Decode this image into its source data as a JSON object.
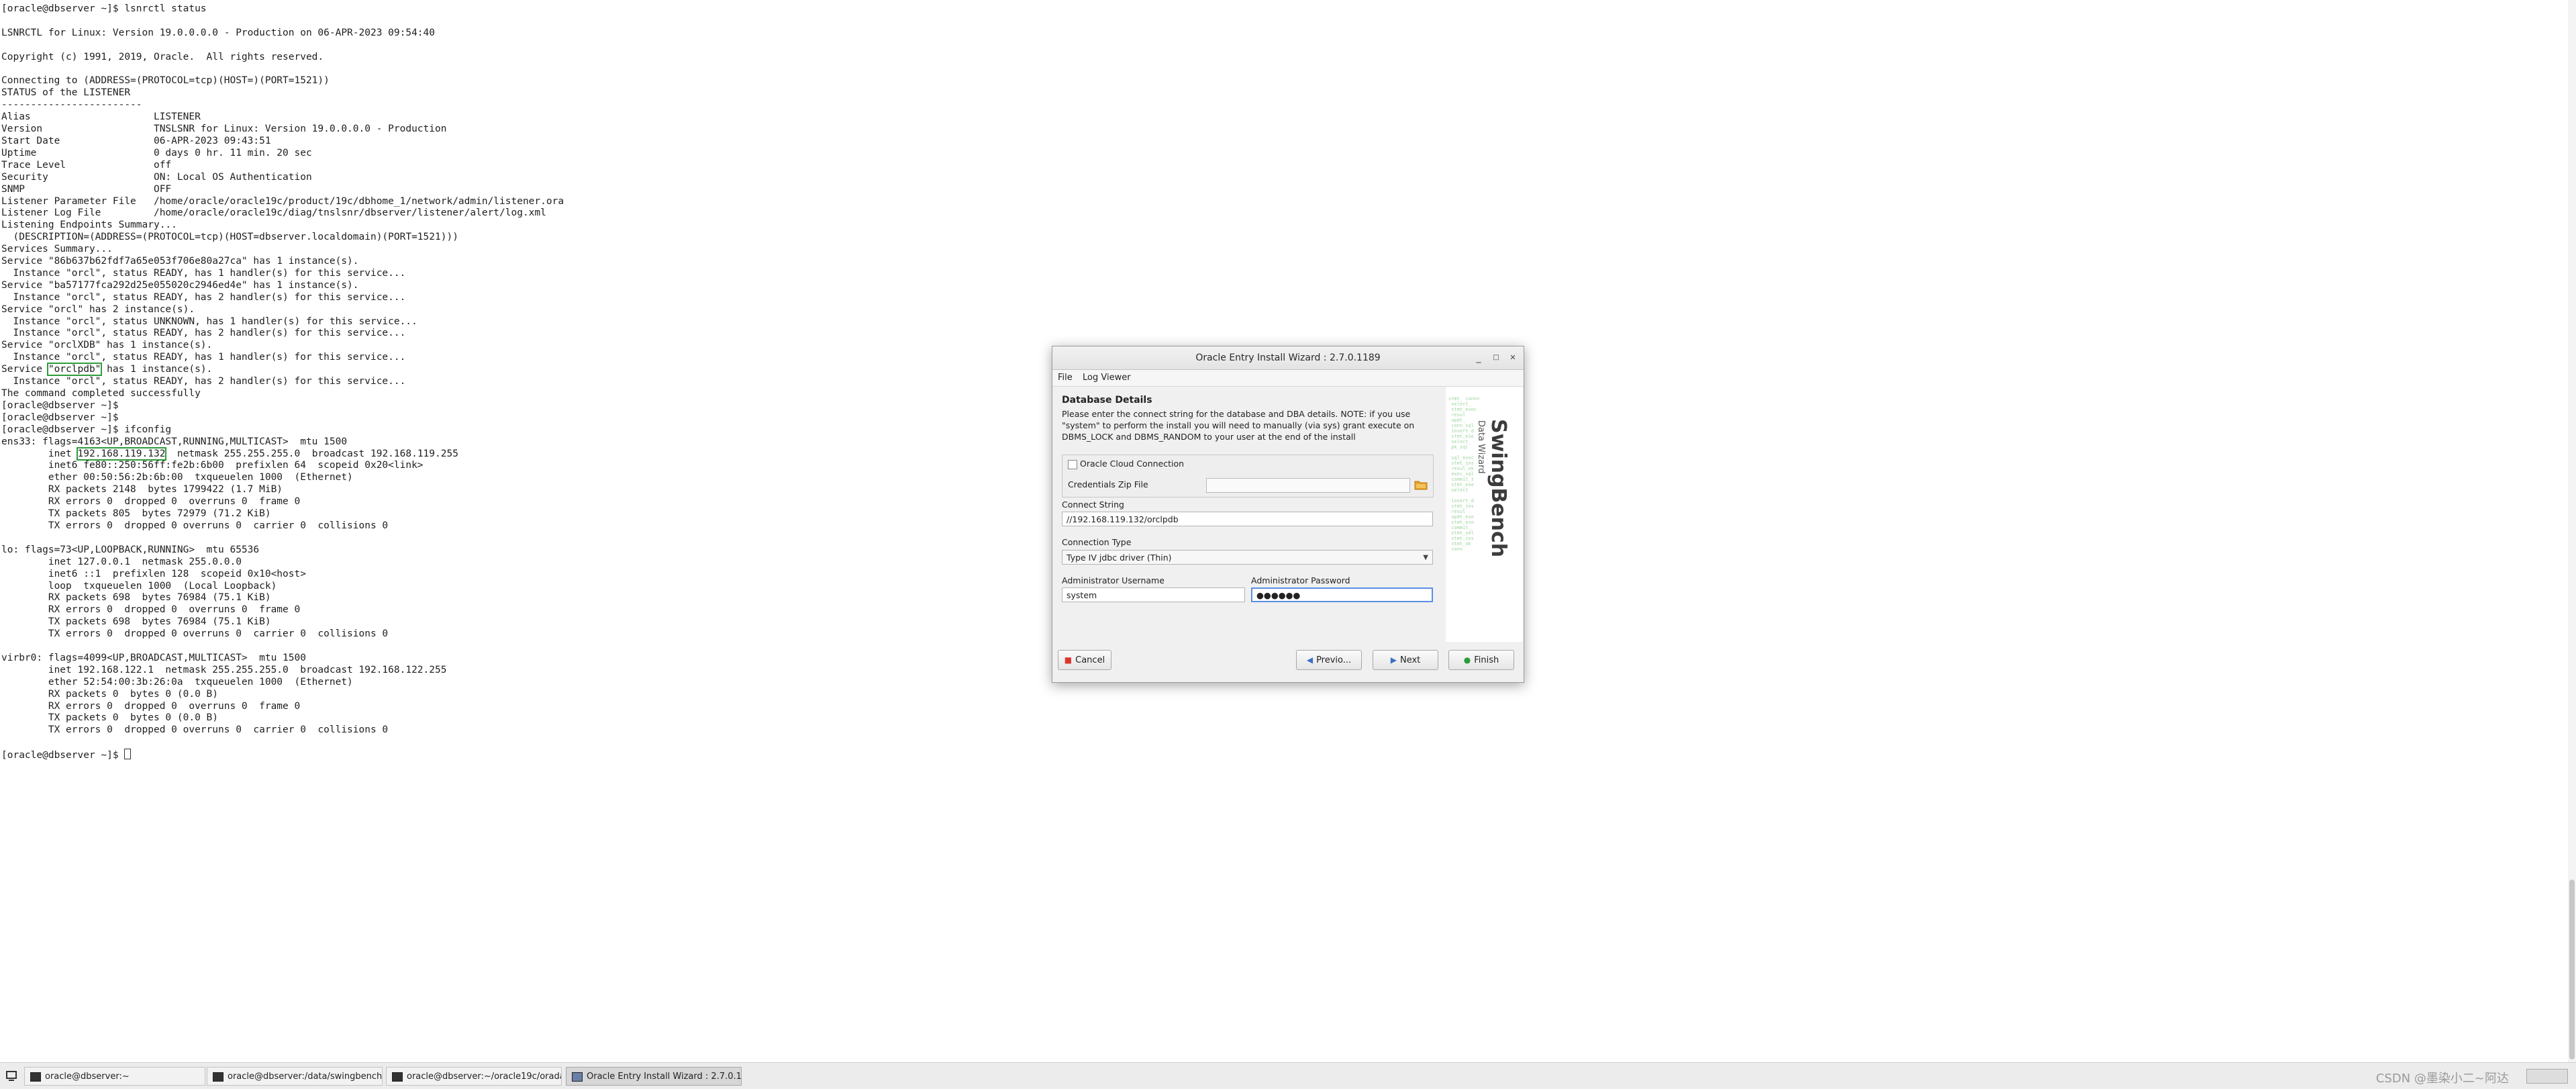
{
  "terminal": {
    "lines": [
      "[oracle@dbserver ~]$ lsnrctl status",
      "",
      "LSNRCTL for Linux: Version 19.0.0.0.0 - Production on 06-APR-2023 09:54:40",
      "",
      "Copyright (c) 1991, 2019, Oracle.  All rights reserved.",
      "",
      "Connecting to (ADDRESS=(PROTOCOL=tcp)(HOST=)(PORT=1521))",
      "STATUS of the LISTENER",
      "------------------------",
      "Alias                     LISTENER",
      "Version                   TNSLSNR for Linux: Version 19.0.0.0.0 - Production",
      "Start Date                06-APR-2023 09:43:51",
      "Uptime                    0 days 0 hr. 11 min. 20 sec",
      "Trace Level               off",
      "Security                  ON: Local OS Authentication",
      "SNMP                      OFF",
      "Listener Parameter File   /home/oracle/oracle19c/product/19c/dbhome_1/network/admin/listener.ora",
      "Listener Log File         /home/oracle/oracle19c/diag/tnslsnr/dbserver/listener/alert/log.xml",
      "Listening Endpoints Summary...",
      "  (DESCRIPTION=(ADDRESS=(PROTOCOL=tcp)(HOST=dbserver.localdomain)(PORT=1521)))",
      "Services Summary...",
      "Service \"86b637b62fdf7a65e053f706e80a27ca\" has 1 instance(s).",
      "  Instance \"orcl\", status READY, has 1 handler(s) for this service...",
      "Service \"ba57177fca292d25e055020c2946ed4e\" has 1 instance(s).",
      "  Instance \"orcl\", status READY, has 2 handler(s) for this service...",
      "Service \"orcl\" has 2 instance(s).",
      "  Instance \"orcl\", status UNKNOWN, has 1 handler(s) for this service...",
      "  Instance \"orcl\", status READY, has 2 handler(s) for this service...",
      "Service \"orclXDB\" has 1 instance(s).",
      "  Instance \"orcl\", status READY, has 1 handler(s) for this service...",
      "Service \"orclpdb\" has 1 instance(s).",
      "  Instance \"orcl\", status READY, has 2 handler(s) for this service...",
      "The command completed successfully",
      "[oracle@dbserver ~]$",
      "[oracle@dbserver ~]$",
      "[oracle@dbserver ~]$ ifconfig",
      "ens33: flags=4163<UP,BROADCAST,RUNNING,MULTICAST>  mtu 1500",
      "        inet 192.168.119.132  netmask 255.255.255.0  broadcast 192.168.119.255",
      "        inet6 fe80::250:56ff:fe2b:6b00  prefixlen 64  scopeid 0x20<link>",
      "        ether 00:50:56:2b:6b:00  txqueuelen 1000  (Ethernet)",
      "        RX packets 2148  bytes 1799422 (1.7 MiB)",
      "        RX errors 0  dropped 0  overruns 0  frame 0",
      "        TX packets 805  bytes 72979 (71.2 KiB)",
      "        TX errors 0  dropped 0 overruns 0  carrier 0  collisions 0",
      "",
      "lo: flags=73<UP,LOOPBACK,RUNNING>  mtu 65536",
      "        inet 127.0.0.1  netmask 255.0.0.0",
      "        inet6 ::1  prefixlen 128  scopeid 0x10<host>",
      "        loop  txqueuelen 1000  (Local Loopback)",
      "        RX packets 698  bytes 76984 (75.1 KiB)",
      "        RX errors 0  dropped 0  overruns 0  frame 0",
      "        TX packets 698  bytes 76984 (75.1 KiB)",
      "        TX errors 0  dropped 0 overruns 0  carrier 0  collisions 0",
      "",
      "virbr0: flags=4099<UP,BROADCAST,MULTICAST>  mtu 1500",
      "        inet 192.168.122.1  netmask 255.255.255.0  broadcast 192.168.122.255",
      "        ether 52:54:00:3b:26:0a  txqueuelen 1000  (Ethernet)",
      "        RX packets 0  bytes 0 (0.0 B)",
      "        RX errors 0  dropped 0  overruns 0  frame 0",
      "        TX packets 0  bytes 0 (0.0 B)",
      "        TX errors 0  dropped 0 overruns 0  carrier 0  collisions 0",
      "",
      "[oracle@dbserver ~]$ "
    ],
    "highlights": [
      {
        "line": 30,
        "text": "\"orclpdb\""
      },
      {
        "line": 37,
        "text": "192.168.119.132"
      }
    ]
  },
  "wizard": {
    "title": "Oracle Entry Install Wizard : 2.7.0.1189",
    "window_controls": {
      "minimize": "_",
      "maximize": "□",
      "close": "✕"
    },
    "menu": [
      "File",
      "Log Viewer"
    ],
    "section_title": "Database Details",
    "description": "Please enter the connect string for the database and DBA details. NOTE: if you use \"system\" to perform the install you will need to manually (via sys) grant execute on DBMS_LOCK and DBMS_RANDOM to your user at the end of the install",
    "cloud_checkbox_label": "Oracle Cloud Connection",
    "credentials_zip_label": "Credentials Zip File",
    "credentials_zip_value": "",
    "connect_string_label": "Connect String",
    "connect_string_value": "//192.168.119.132/orclpdb",
    "connection_type_label": "Connection Type",
    "connection_type_value": "Type IV jdbc driver (Thin)",
    "admin_user_label": "Administrator Username",
    "admin_user_value": "system",
    "admin_pass_label": "Administrator Password",
    "admin_pass_value": "●●●●●●",
    "banner_brand": "SwingBench",
    "banner_sub": "Data Wizard",
    "buttons": {
      "cancel": "Cancel",
      "previous": "Previo...",
      "next": "Next",
      "finish": "Finish"
    },
    "icons": {
      "cancel": "cancel-icon",
      "previous": "back-arrow-icon",
      "next": "forward-arrow-icon",
      "finish": "finish-icon",
      "folder": "folder-icon"
    }
  },
  "taskbar": {
    "items": [
      {
        "label": "oracle@dbserver:~",
        "active": false
      },
      {
        "label": "oracle@dbserver:/data/swingbench/...",
        "active": false
      },
      {
        "label": "oracle@dbserver:~/oracle19c/orada...",
        "active": false
      },
      {
        "label": "Oracle Entry Install Wizard : 2.7.0.1...",
        "active": true
      }
    ],
    "watermark": "CSDN @墨染小二~阿达"
  },
  "colors": {
    "highlight_box": "#2e9b3b",
    "focus_border": "#5b8ee6",
    "cancel_icon": "#d9362b",
    "finish_icon": "#2e9b3b",
    "folder_icon": "#e7a028"
  }
}
